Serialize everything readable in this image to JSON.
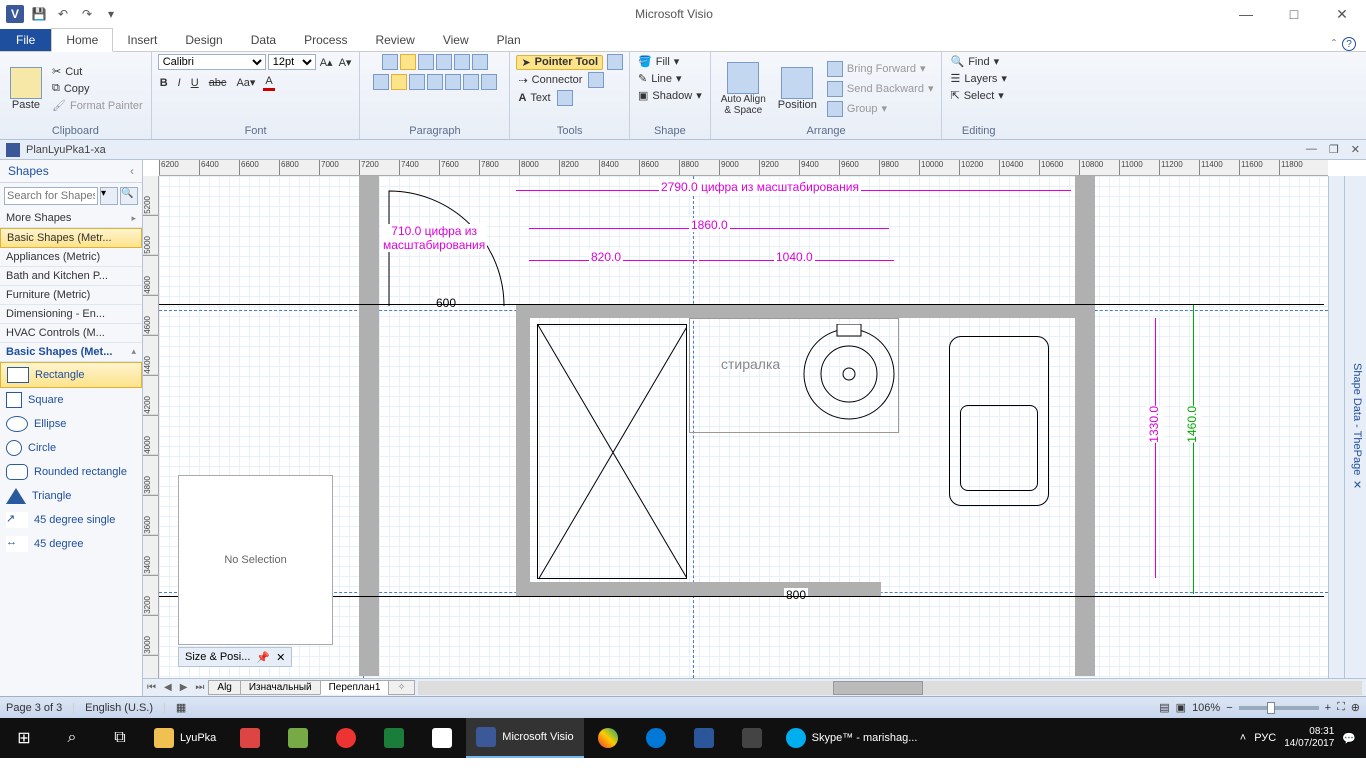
{
  "app": {
    "title": "Microsoft Visio"
  },
  "qat": {
    "logo": "V"
  },
  "tabs": {
    "file": "File",
    "home": "Home",
    "insert": "Insert",
    "design": "Design",
    "data": "Data",
    "process": "Process",
    "review": "Review",
    "view": "View",
    "plan": "Plan"
  },
  "ribbon": {
    "clipboard": {
      "paste": "Paste",
      "cut": "Cut",
      "copy": "Copy",
      "formatpainter": "Format Painter",
      "label": "Clipboard"
    },
    "font": {
      "family": "Calibri",
      "size": "12pt",
      "label": "Font"
    },
    "paragraph": {
      "label": "Paragraph"
    },
    "tools": {
      "pointer": "Pointer Tool",
      "connector": "Connector",
      "text": "Text",
      "label": "Tools"
    },
    "shape": {
      "fill": "Fill",
      "line": "Line",
      "shadow": "Shadow",
      "label": "Shape"
    },
    "arrange": {
      "autoalign": "Auto Align\n& Space",
      "position": "Position",
      "bringfwd": "Bring Forward",
      "sendback": "Send Backward",
      "group": "Group",
      "label": "Arrange"
    },
    "editing": {
      "find": "Find",
      "layers": "Layers",
      "select": "Select",
      "label": "Editing"
    }
  },
  "document": {
    "name": "PlanLyuPka1-xa"
  },
  "shapes": {
    "title": "Shapes",
    "search_placeholder": "Search for Shapes",
    "more": "More Shapes",
    "stencils": [
      "Basic Shapes (Metr...",
      "Appliances (Metric)",
      "Bath and Kitchen P...",
      "Furniture (Metric)",
      "Dimensioning - En...",
      "HVAC Controls (M..."
    ],
    "active_stencil": "Basic Shapes (Met...",
    "items": [
      "Rectangle",
      "Square",
      "Ellipse",
      "Circle",
      "Rounded rectangle",
      "Triangle",
      "45 degree single",
      "45 degree"
    ]
  },
  "rulerH": [
    "6200",
    "6400",
    "6600",
    "6800",
    "7000",
    "7200",
    "7400",
    "7600",
    "7800",
    "8000",
    "8200",
    "8400",
    "8600",
    "8800",
    "9000",
    "9200",
    "9400",
    "9600",
    "9800",
    "10000",
    "10200",
    "10400",
    "10600",
    "10800",
    "11000",
    "11200",
    "11400",
    "11600",
    "11800"
  ],
  "rulerV": [
    "5200",
    "5000",
    "4800",
    "4600",
    "4400",
    "4200",
    "4000",
    "3800",
    "3600",
    "3400",
    "3200",
    "3000"
  ],
  "drawing": {
    "dim_full": "2790.0 цифра из масштабирования",
    "dim_door_label1": "710.0 цифра из",
    "dim_door_label2": "масштабирования",
    "dim_s1": "1860.0",
    "dim_s2": "820.0",
    "dim_s3": "1040.0",
    "dim_600": "600",
    "dim_800": "800",
    "dim_1330": "1330.0",
    "dim_1460": "1460.0",
    "washer": "стиралка"
  },
  "floating": {
    "nosel": "No Selection",
    "sizepos": "Size & Posi..."
  },
  "shapedata": "Shape Data - ThePage",
  "sheets": {
    "s1": "Alg",
    "s2": "Изначальный",
    "s3": "Переплан1"
  },
  "status": {
    "page": "Page 3 of 3",
    "lang": "English (U.S.)",
    "zoom": "106%"
  },
  "taskbar": {
    "folder": "LyuPka",
    "visio": "Microsoft Visio",
    "skype": "Skype™ - marishag...",
    "lang": "РУС",
    "time": "08:31",
    "date": "14/07/2017"
  }
}
